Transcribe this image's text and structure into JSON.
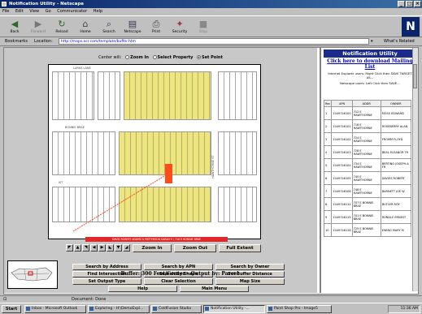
{
  "window": {
    "title": "Notification Utility - Netscape"
  },
  "menu": [
    "File",
    "Edit",
    "View",
    "Go",
    "Communicator",
    "Help"
  ],
  "toolbar": {
    "buttons": [
      {
        "label": "Back",
        "icon": "back-arrow-icon"
      },
      {
        "label": "Forward",
        "icon": "forward-arrow-icon"
      },
      {
        "label": "Reload",
        "icon": "reload-icon"
      },
      {
        "label": "Home",
        "icon": "home-icon"
      },
      {
        "label": "Search",
        "icon": "search-icon"
      },
      {
        "label": "Netscape",
        "icon": "netscape-icon"
      },
      {
        "label": "Print",
        "icon": "print-icon"
      },
      {
        "label": "Security",
        "icon": "security-lock-icon"
      },
      {
        "label": "Stop",
        "icon": "stop-icon"
      }
    ],
    "logo": "N"
  },
  "location": {
    "bookmarks": "Bookmarks",
    "label": "Location:",
    "url": "http://maps.acr.com/template/buffer.htm",
    "whats_related": "What's Related"
  },
  "map_page": {
    "center_label": "Center will:",
    "center_options": [
      {
        "label": "Zoom In",
        "checked": false
      },
      {
        "label": "Select Property",
        "checked": false
      },
      {
        "label": "Set Point",
        "checked": true
      }
    ],
    "streets": [
      "LARKS LANE",
      "BONNIE BRAE",
      "IST",
      "HAWTHORNE ST"
    ],
    "buffer_label": "DAVIS ROBERT ADAMS & PATTERSON SARAH E / 716 E BONNIE BRAE",
    "nav_arrows": [
      "◤",
      "▲",
      "◥",
      "◀",
      "▶",
      "◣",
      "▼",
      "◢"
    ],
    "zoom_buttons": [
      "Zoom In",
      "Zoom Out",
      "Full Extent"
    ],
    "function_buttons": [
      [
        "Search by Address",
        "Search by APN",
        "Search by Owner"
      ],
      [
        "Find Intersection",
        "Search by Shape",
        "Set Buffer Distance"
      ],
      [
        "Set Output Type",
        "Clear Selection",
        "Map Size"
      ]
    ],
    "bottom_buttons": [
      "Help",
      "Main Menu"
    ],
    "buffer_text": "Buffer: 300 Feet/Center - Output by: Parcel"
  },
  "panel": {
    "title": "Notification Utility",
    "link": "Click here to download Mailing List",
    "note_ie": "Internet Explorer users: Right Click then SAVE TARGET AS...",
    "note_ns": "Netscape users: Left Click then SAVE...",
    "columns": [
      "Rec",
      "APN",
      "ADDR",
      "OWNER"
    ],
    "rows": [
      [
        "1",
        "1049746100",
        "712 E HAWTHORNE",
        "MOSS EDWARD"
      ],
      [
        "2",
        "1049746101",
        "718 E HAWTHORNE",
        "ROSEBERRY ALAN"
      ],
      [
        "3",
        "1049746102",
        "724 E HAWTHORNE",
        "FROMM FLOYD"
      ],
      [
        "4",
        "1049746103",
        "728 E HAWTHORNE",
        "BEAL ELEANOR TR"
      ],
      [
        "5",
        "1049746104",
        "734 E HAWTHORNE",
        "BERTINO JOSEPH A TR"
      ],
      [
        "6",
        "1049746105",
        "740 E HAWTHORNE",
        "DAVIES ROBERT"
      ],
      [
        "7",
        "1049746106",
        "748 E HAWTHORNE",
        "BARNETT JOE W"
      ],
      [
        "8",
        "1049746114",
        "707 E BONNIE BRAE",
        "BUTLER ROY"
      ],
      [
        "9",
        "1049746115",
        "701 E BONNIE BRAE",
        "RUNDLE ERNEST"
      ],
      [
        "10",
        "1049746116",
        "725 E BONNIE BRAE",
        "EWING MARY M"
      ]
    ]
  },
  "status": {
    "text": "Document: Done"
  },
  "taskbar": {
    "start": "Start",
    "tasks": [
      "Inbox - Microsoft Outlook",
      "Exploring - H:\\DemoExpl...",
      "ColdFusion Studio",
      "Notification Utility -...",
      "Paint Shop Pro - Image5"
    ],
    "active_task": 3,
    "clock": "11:36 AM"
  },
  "colors": {
    "selected_parcel": "#ff4a1a",
    "buffer_parcels": "#ede580",
    "panel_title_bg": "#1c2c8c",
    "title_bar": "#0a246a"
  }
}
